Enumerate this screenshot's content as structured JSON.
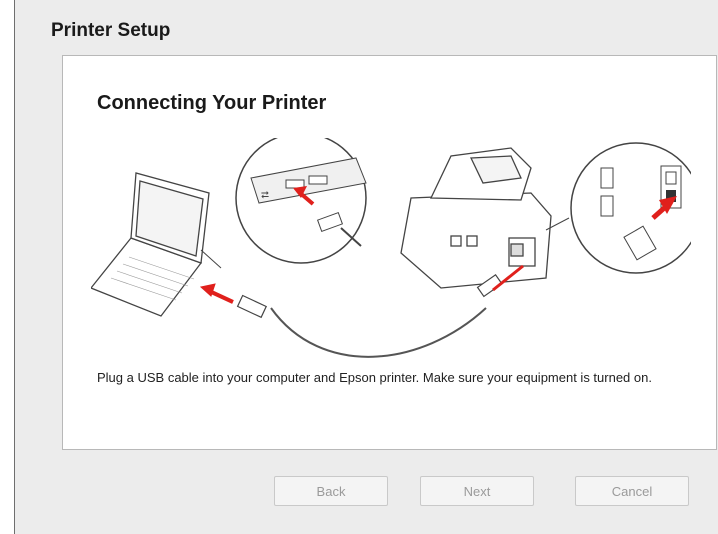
{
  "window": {
    "title": "Printer Setup"
  },
  "panel": {
    "heading": "Connecting Your Printer",
    "description": "Plug a USB cable into your computer and Epson printer. Make sure your equipment is turned on.",
    "illustration": {
      "icon": "usb-connection-illustration",
      "accent_color": "#e0201c"
    }
  },
  "buttons": {
    "back": "Back",
    "next": "Next",
    "cancel": "Cancel"
  }
}
